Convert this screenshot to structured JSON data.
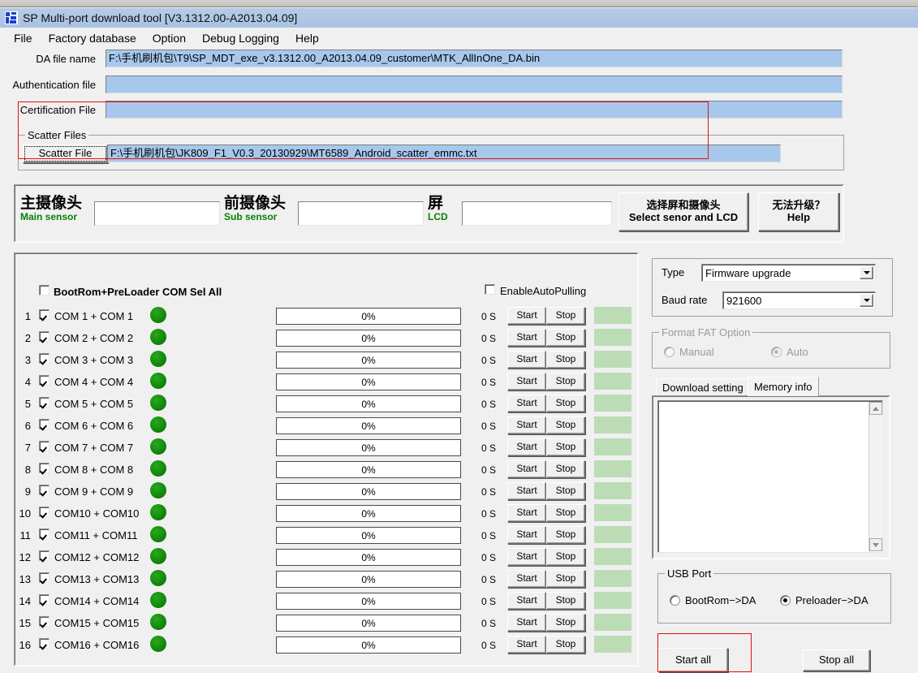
{
  "window": {
    "title": "SP Multi-port download tool [V3.1312.00-A2013.04.09]",
    "icon": "app-icon"
  },
  "menu": {
    "items": [
      "File",
      "Factory database",
      "Option",
      "Debug Logging",
      "Help"
    ]
  },
  "files": {
    "da_label": "DA file name",
    "da_value": "F:\\手机刷机包\\T9\\SP_MDT_exe_v3.1312.00_A2013.04.09_customer\\MTK_AllInOne_DA.bin",
    "auth_label": "Authentication file",
    "auth_value": "",
    "cert_label": "Certification File",
    "cert_value": "",
    "scatter_group_label": "Scatter Files",
    "scatter_button": "Scatter File",
    "scatter_value": "F:\\手机刷机包\\JK809_F1_V0.3_20130929\\MT6589_Android_scatter_emmc.txt"
  },
  "sensors": {
    "main_cn": "主摄像头",
    "main_en": "Main sensor",
    "main_value": "",
    "sub_cn": "前摄像头",
    "sub_en": "Sub sensor",
    "sub_value": "",
    "lcd_cn": "屏",
    "lcd_en": "LCD",
    "lcd_value": "",
    "select_btn_cn": "选择屏和摄像头",
    "select_btn_en": "Select senor and LCD",
    "help_btn_cn": "无法升级？",
    "help_btn_en": "Help"
  },
  "comlist": {
    "sel_all_label": "BootRom+PreLoader COM Sel All",
    "sel_all_checked": false,
    "auto_pulling_label": "EnableAutoPulling",
    "auto_pulling_checked": false,
    "start_label": "Start",
    "stop_label": "Stop",
    "rows": [
      {
        "idx": "1",
        "label": "COM 1 + COM 1",
        "checked": true,
        "progress": "0%",
        "time": "0 S"
      },
      {
        "idx": "2",
        "label": "COM 2 + COM 2",
        "checked": true,
        "progress": "0%",
        "time": "0 S"
      },
      {
        "idx": "3",
        "label": "COM 3 + COM 3",
        "checked": true,
        "progress": "0%",
        "time": "0 S"
      },
      {
        "idx": "4",
        "label": "COM 4 + COM 4",
        "checked": true,
        "progress": "0%",
        "time": "0 S"
      },
      {
        "idx": "5",
        "label": "COM 5 + COM 5",
        "checked": true,
        "progress": "0%",
        "time": "0 S"
      },
      {
        "idx": "6",
        "label": "COM 6 + COM 6",
        "checked": true,
        "progress": "0%",
        "time": "0 S"
      },
      {
        "idx": "7",
        "label": "COM 7 + COM 7",
        "checked": true,
        "progress": "0%",
        "time": "0 S"
      },
      {
        "idx": "8",
        "label": "COM 8 + COM 8",
        "checked": true,
        "progress": "0%",
        "time": "0 S"
      },
      {
        "idx": "9",
        "label": "COM 9 + COM 9",
        "checked": true,
        "progress": "0%",
        "time": "0 S"
      },
      {
        "idx": "10",
        "label": "COM10 + COM10",
        "checked": true,
        "progress": "0%",
        "time": "0 S"
      },
      {
        "idx": "11",
        "label": "COM11 + COM11",
        "checked": true,
        "progress": "0%",
        "time": "0 S"
      },
      {
        "idx": "12",
        "label": "COM12 + COM12",
        "checked": true,
        "progress": "0%",
        "time": "0 S"
      },
      {
        "idx": "13",
        "label": "COM13 + COM13",
        "checked": true,
        "progress": "0%",
        "time": "0 S"
      },
      {
        "idx": "14",
        "label": "COM14 + COM14",
        "checked": true,
        "progress": "0%",
        "time": "0 S"
      },
      {
        "idx": "15",
        "label": "COM15 + COM15",
        "checked": true,
        "progress": "0%",
        "time": "0 S"
      },
      {
        "idx": "16",
        "label": "COM16 + COM16",
        "checked": true,
        "progress": "0%",
        "time": "0 S"
      }
    ]
  },
  "settings": {
    "type_label": "Type",
    "type_value": "Firmware upgrade",
    "baud_label": "Baud rate",
    "baud_value": "921600",
    "fat_group": "Format FAT Option",
    "fat_manual": "Manual",
    "fat_auto": "Auto",
    "fat_selected": "Auto",
    "tabs": [
      {
        "label": "Download setting",
        "active": false
      },
      {
        "label": "Memory info",
        "active": true
      }
    ],
    "memory_text": "",
    "usb_group": "USB Port",
    "usb_bootrom": "BootRom−>DA",
    "usb_preloader": "Preloader−>DA",
    "usb_selected": "Preloader−>DA",
    "start_all": "Start all",
    "stop_all": "Stop all"
  },
  "colors": {
    "led_green": "#138a0c",
    "status_green": "#bcdcb6",
    "field_blue": "#a7c8ec",
    "label_green": "#068106",
    "highlight_red": "#e01010",
    "titlebar_blue": "#a9c2e3"
  }
}
